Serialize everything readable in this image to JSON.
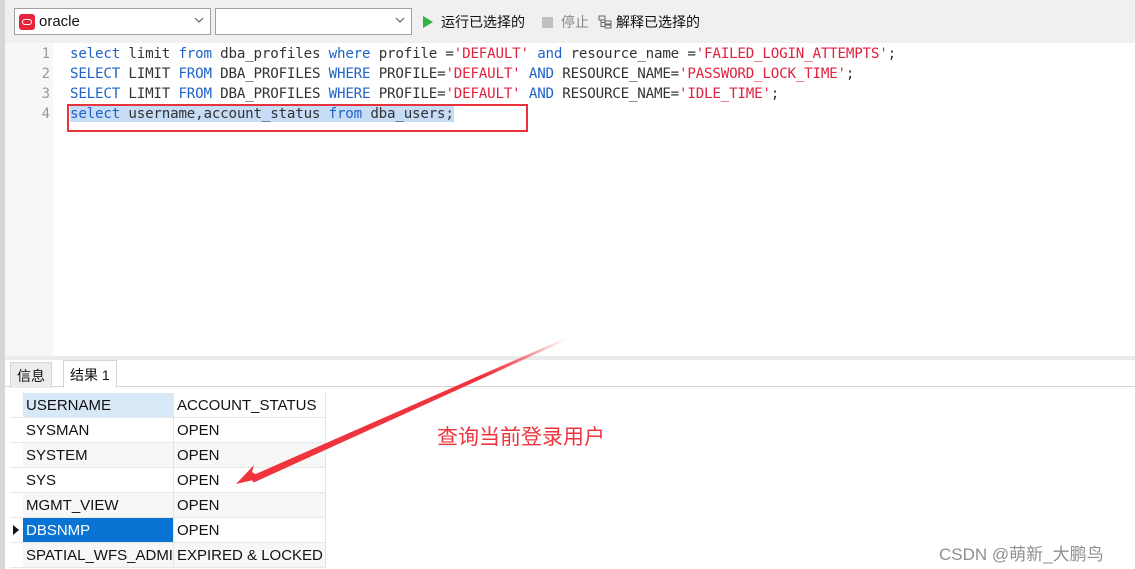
{
  "toolbar": {
    "connection_select": {
      "value": "oracle",
      "icon": "oracle-db-icon"
    },
    "database_select": {
      "value": ""
    },
    "run_selected_label": "运行已选择的",
    "stop_label": "停止",
    "explain_selected_label": "解释已选择的"
  },
  "editor": {
    "lines": [
      {
        "number": "1",
        "tokens": [
          {
            "t": "select",
            "c": "kw"
          },
          {
            "t": " limit ",
            "c": ""
          },
          {
            "t": "from",
            "c": "kw"
          },
          {
            "t": " dba_profiles ",
            "c": ""
          },
          {
            "t": "where",
            "c": "kw"
          },
          {
            "t": " profile =",
            "c": ""
          },
          {
            "t": "'DEFAULT'",
            "c": "str"
          },
          {
            "t": " ",
            "c": ""
          },
          {
            "t": "and",
            "c": "kw"
          },
          {
            "t": " resource_name =",
            "c": ""
          },
          {
            "t": "'FAILED_LOGIN_ATTEMPTS'",
            "c": "str"
          },
          {
            "t": ";",
            "c": ""
          }
        ]
      },
      {
        "number": "2",
        "tokens": [
          {
            "t": "SELECT",
            "c": "kw"
          },
          {
            "t": " LIMIT ",
            "c": ""
          },
          {
            "t": "FROM",
            "c": "kw"
          },
          {
            "t": " DBA_PROFILES ",
            "c": ""
          },
          {
            "t": "WHERE",
            "c": "kw"
          },
          {
            "t": " PROFILE=",
            "c": ""
          },
          {
            "t": "'DEFAULT'",
            "c": "str"
          },
          {
            "t": " ",
            "c": ""
          },
          {
            "t": "AND",
            "c": "kw"
          },
          {
            "t": " RESOURCE_NAME=",
            "c": ""
          },
          {
            "t": "'PASSWORD_LOCK_TIME'",
            "c": "str"
          },
          {
            "t": ";",
            "c": ""
          }
        ]
      },
      {
        "number": "3",
        "tokens": [
          {
            "t": "SELECT",
            "c": "kw"
          },
          {
            "t": " LIMIT ",
            "c": ""
          },
          {
            "t": "FROM",
            "c": "kw"
          },
          {
            "t": " DBA_PROFILES ",
            "c": ""
          },
          {
            "t": "WHERE",
            "c": "kw"
          },
          {
            "t": " PROFILE=",
            "c": ""
          },
          {
            "t": "'DEFAULT'",
            "c": "str"
          },
          {
            "t": " ",
            "c": ""
          },
          {
            "t": "AND",
            "c": "kw"
          },
          {
            "t": " RESOURCE_NAME=",
            "c": ""
          },
          {
            "t": "'IDLE_TIME'",
            "c": "str"
          },
          {
            "t": ";",
            "c": ""
          }
        ]
      },
      {
        "number": "4",
        "selected": true,
        "tokens": [
          {
            "t": "select",
            "c": "kw"
          },
          {
            "t": " username,account_status ",
            "c": ""
          },
          {
            "t": "from",
            "c": "kw"
          },
          {
            "t": " dba_users;",
            "c": ""
          }
        ]
      }
    ]
  },
  "result_panel": {
    "tabs": [
      {
        "label": "信息",
        "active": false
      },
      {
        "label": "结果 1",
        "active": true
      }
    ],
    "columns": [
      "USERNAME",
      "ACCOUNT_STATUS"
    ],
    "rows": [
      [
        "SYSMAN",
        "OPEN"
      ],
      [
        "SYSTEM",
        "OPEN"
      ],
      [
        "SYS",
        "OPEN"
      ],
      [
        "MGMT_VIEW",
        "OPEN"
      ],
      [
        "DBSNMP",
        "OPEN"
      ],
      [
        "SPATIAL_WFS_ADMI",
        "EXPIRED & LOCKED"
      ]
    ],
    "selected_row_index": 4
  },
  "annotation": {
    "text": "查询当前登录用户",
    "color": "#f0343e"
  },
  "watermark": "CSDN @萌新_大鹏鸟",
  "colors": {
    "keyword": "#1f63c9",
    "string": "#e2213f",
    "selection": "#c7dcf5",
    "selected_row": "#0a74d4",
    "highlight_box": "#e8333d",
    "run_icon": "#2fb344"
  }
}
